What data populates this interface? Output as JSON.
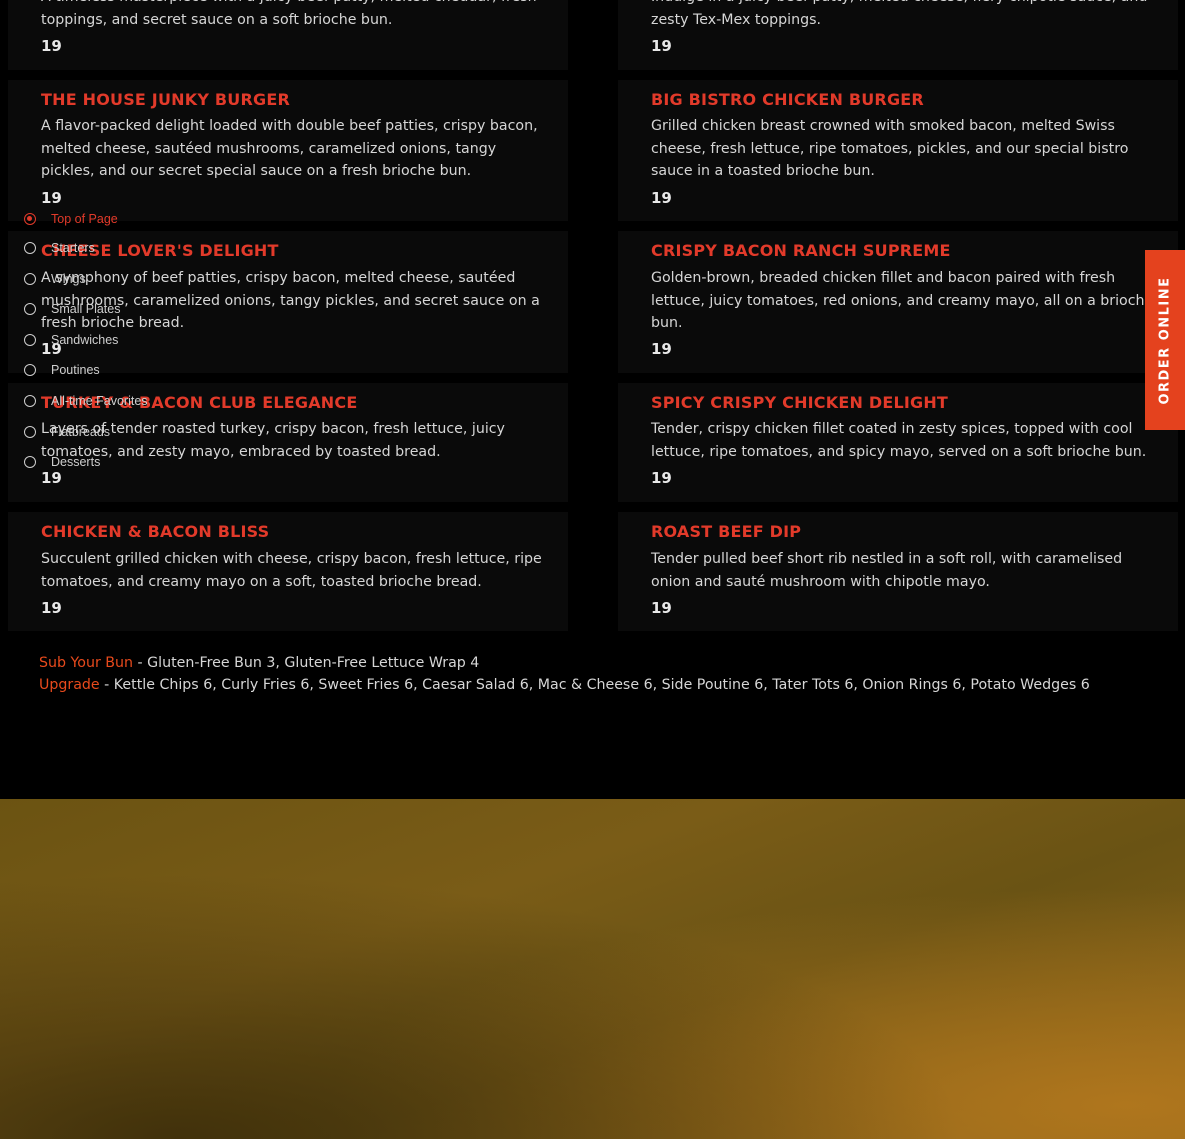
{
  "top_partial": {
    "left": {
      "desc": "A timeless masterpiece with a juicy beef patty, melted cheddar, fresh toppings, and secret sauce on a soft brioche bun.",
      "price": "19"
    },
    "right": {
      "desc": "Indulge in a juicy beef patty, melted cheese, fiery chipotle sauce, and zesty Tex-Mex toppings.",
      "price": "19"
    }
  },
  "menu_items": [
    {
      "title": "THE HOUSE JUNKY BURGER",
      "desc": "A flavor-packed delight loaded with double beef patties, crispy bacon, melted cheese, sautéed mushrooms, caramelized onions, tangy pickles, and our secret special sauce on a fresh brioche bun.",
      "price": "19"
    },
    {
      "title": "BIG BISTRO CHICKEN BURGER",
      "desc": "Grilled chicken breast crowned with smoked bacon, melted Swiss cheese, fresh lettuce, ripe tomatoes, pickles, and our special bistro sauce in a toasted brioche bun.",
      "price": "19"
    },
    {
      "title": "CHEESE LOVER'S DELIGHT",
      "desc": "A symphony of beef patties, crispy bacon, melted cheese, sautéed mushrooms, caramelized onions, tangy pickles, and secret sauce on a fresh brioche bread.",
      "price": "19"
    },
    {
      "title": "CRISPY BACON RANCH SUPREME",
      "desc": "Golden-brown, breaded chicken fillet and bacon paired with fresh lettuce, juicy tomatoes, red onions, and creamy mayo, all on a brioche bun.",
      "price": "19"
    },
    {
      "title": "TURKEY & BACON CLUB ELEGANCE",
      "desc": "Layers of tender roasted turkey, crispy bacon, fresh lettuce, juicy tomatoes, and zesty mayo, embraced by toasted bread.",
      "price": "19"
    },
    {
      "title": "SPICY CRISPY CHICKEN DELIGHT",
      "desc": "Tender, crispy chicken fillet coated in zesty spices, topped with cool lettuce, ripe tomatoes, and spicy mayo, served on a soft brioche bun.",
      "price": "19"
    },
    {
      "title": "CHICKEN & BACON BLISS",
      "desc": "Succulent grilled chicken with cheese, crispy bacon, fresh lettuce, ripe tomatoes, and creamy mayo on a soft, toasted brioche bread.",
      "price": "19"
    },
    {
      "title": "ROAST BEEF DIP",
      "desc": "Tender pulled beef short rib nestled in a soft roll, with caramelised onion and sauté mushroom with chipotle mayo.",
      "price": "19"
    }
  ],
  "extras": {
    "sub_label": "Sub Your Bun",
    "sub_text": " - Gluten-Free Bun  3, Gluten-Free Lettuce Wrap  4",
    "upgrade_label": "Upgrade",
    "upgrade_text": " - Kettle Chips  6, Curly Fries  6, Sweet Fries  6, Caesar Salad  6, Mac & Cheese  6, Side Poutine  6, Tater Tots  6, Onion Rings  6, Potato Wedges  6"
  },
  "nav": {
    "items": [
      {
        "label": "Top of Page",
        "active": true
      },
      {
        "label": "Starters",
        "active": false
      },
      {
        "label": "Wings",
        "active": false
      },
      {
        "label": "Small Plates",
        "active": false
      },
      {
        "label": "Sandwiches",
        "active": false
      },
      {
        "label": "Poutines",
        "active": false
      },
      {
        "label": "All-time Favorites",
        "active": false
      },
      {
        "label": "Flatbreads",
        "active": false
      },
      {
        "label": "Desserts",
        "active": false
      }
    ]
  },
  "order_tab": {
    "label": "ORDER ONLINE"
  },
  "colors": {
    "accent": "#e23a2a",
    "order_tab": "#e4421e",
    "highlight": "#e84a1c",
    "card_bg": "#0a0a0a",
    "page_bg": "#000000",
    "footer_gold": "#7a5c17"
  }
}
